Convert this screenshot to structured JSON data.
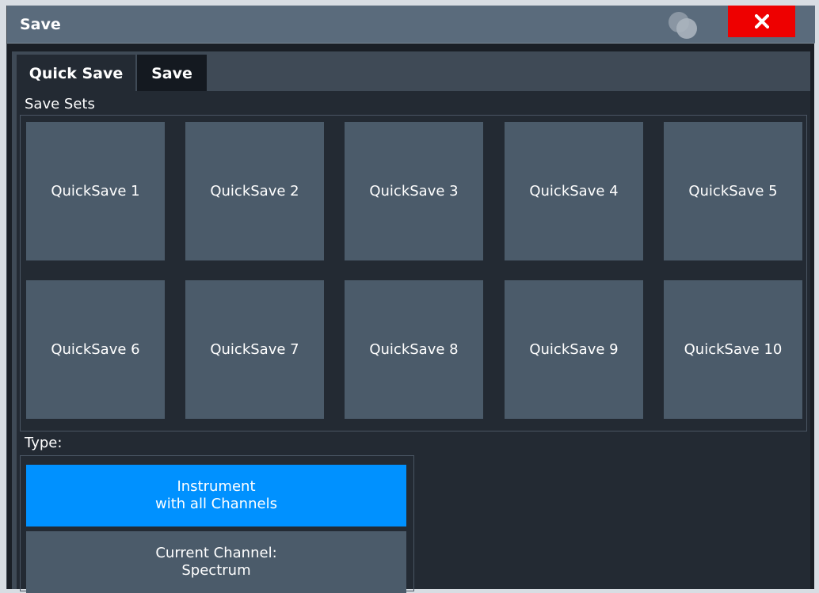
{
  "window": {
    "title": "Save",
    "close_label": "X"
  },
  "tabs": [
    {
      "label": "Quick Save",
      "active": true
    },
    {
      "label": "Save",
      "active": false
    }
  ],
  "save_sets": {
    "label": "Save Sets",
    "items": [
      "QuickSave 1",
      "QuickSave 2",
      "QuickSave 3",
      "QuickSave 4",
      "QuickSave 5",
      "QuickSave 6",
      "QuickSave 7",
      "QuickSave 8",
      "QuickSave 9",
      "QuickSave 10"
    ]
  },
  "type": {
    "label": "Type:",
    "options": [
      {
        "line1": "Instrument",
        "line2": "with all Channels",
        "selected": true
      },
      {
        "line1": "Current Channel:",
        "line2": "Spectrum",
        "selected": false
      }
    ]
  },
  "colors": {
    "accent": "#0091ff",
    "close": "#ee0000",
    "button": "#4b5b6a",
    "title_bar": "#5a6b7c"
  },
  "icons": [
    "help-bubbles-icon",
    "close-icon"
  ]
}
